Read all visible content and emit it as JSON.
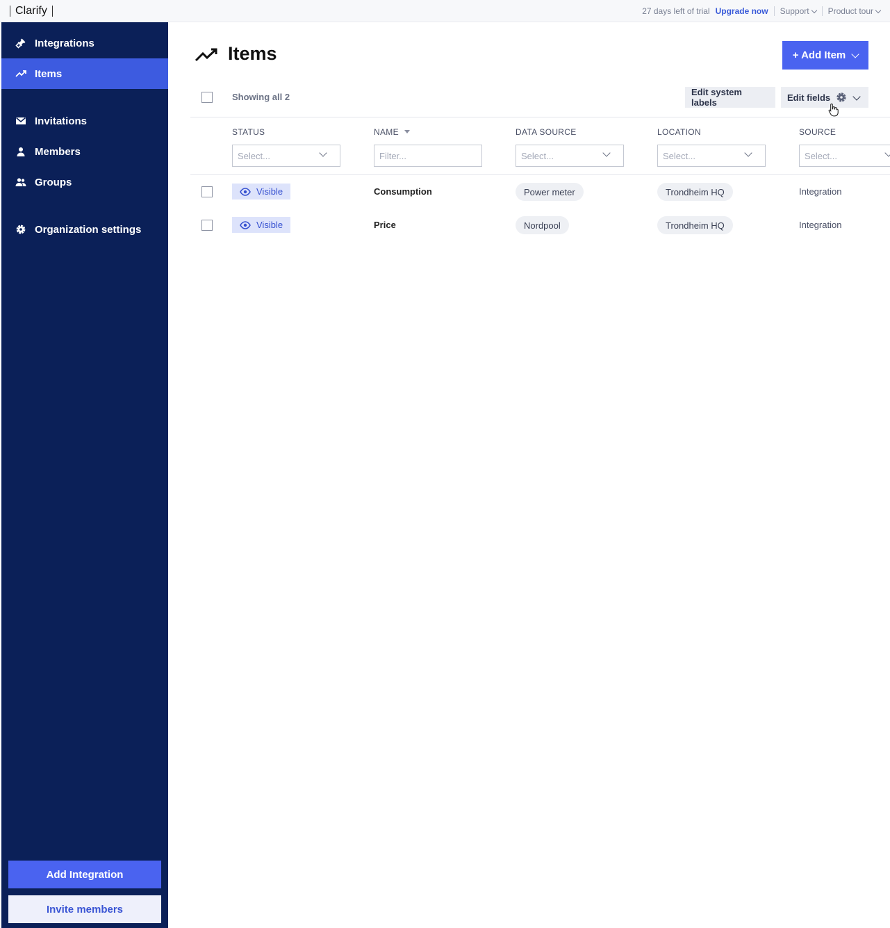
{
  "topbar": {
    "brand": "Clarify",
    "trial_text": "27 days left of trial",
    "upgrade_label": "Upgrade now",
    "support_label": "Support",
    "product_tour_label": "Product tour"
  },
  "sidebar": {
    "items": [
      {
        "label": "Integrations",
        "icon": "plug-icon",
        "active": false
      },
      {
        "label": "Items",
        "icon": "trend-icon",
        "active": true
      },
      {
        "label": "Invitations",
        "icon": "envelope-icon",
        "active": false
      },
      {
        "label": "Members",
        "icon": "person-icon",
        "active": false
      },
      {
        "label": "Groups",
        "icon": "people-icon",
        "active": false
      },
      {
        "label": "Organization settings",
        "icon": "gear-icon",
        "active": false
      }
    ],
    "add_integration_label": "Add Integration",
    "invite_members_label": "Invite members"
  },
  "main": {
    "title": "Items",
    "add_item_label": "+ Add Item",
    "showing_text": "Showing all 2",
    "edit_system_labels": "Edit system labels",
    "edit_fields": "Edit fields",
    "columns": [
      {
        "header": "STATUS",
        "filter_placeholder": "Select...",
        "filter_type": "select"
      },
      {
        "header": "NAME",
        "filter_placeholder": "Filter...",
        "filter_type": "text",
        "sorted": "desc"
      },
      {
        "header": "DATA SOURCE",
        "filter_placeholder": "Select...",
        "filter_type": "select"
      },
      {
        "header": "LOCATION",
        "filter_placeholder": "Select...",
        "filter_type": "select"
      },
      {
        "header": "SOURCE",
        "filter_placeholder": "Select...",
        "filter_type": "select"
      }
    ],
    "rows": [
      {
        "status": "Visible",
        "name": "Consumption",
        "data_source": "Power meter",
        "location": "Trondheim HQ",
        "source": "Integration"
      },
      {
        "status": "Visible",
        "name": "Price",
        "data_source": "Nordpool",
        "location": "Trondheim HQ",
        "source": "Integration"
      }
    ]
  },
  "colors": {
    "sidebar_bg": "#0b2058",
    "accent": "#4a63f0",
    "active_nav": "#3d5be0",
    "badge_bg": "#dde3fb"
  }
}
